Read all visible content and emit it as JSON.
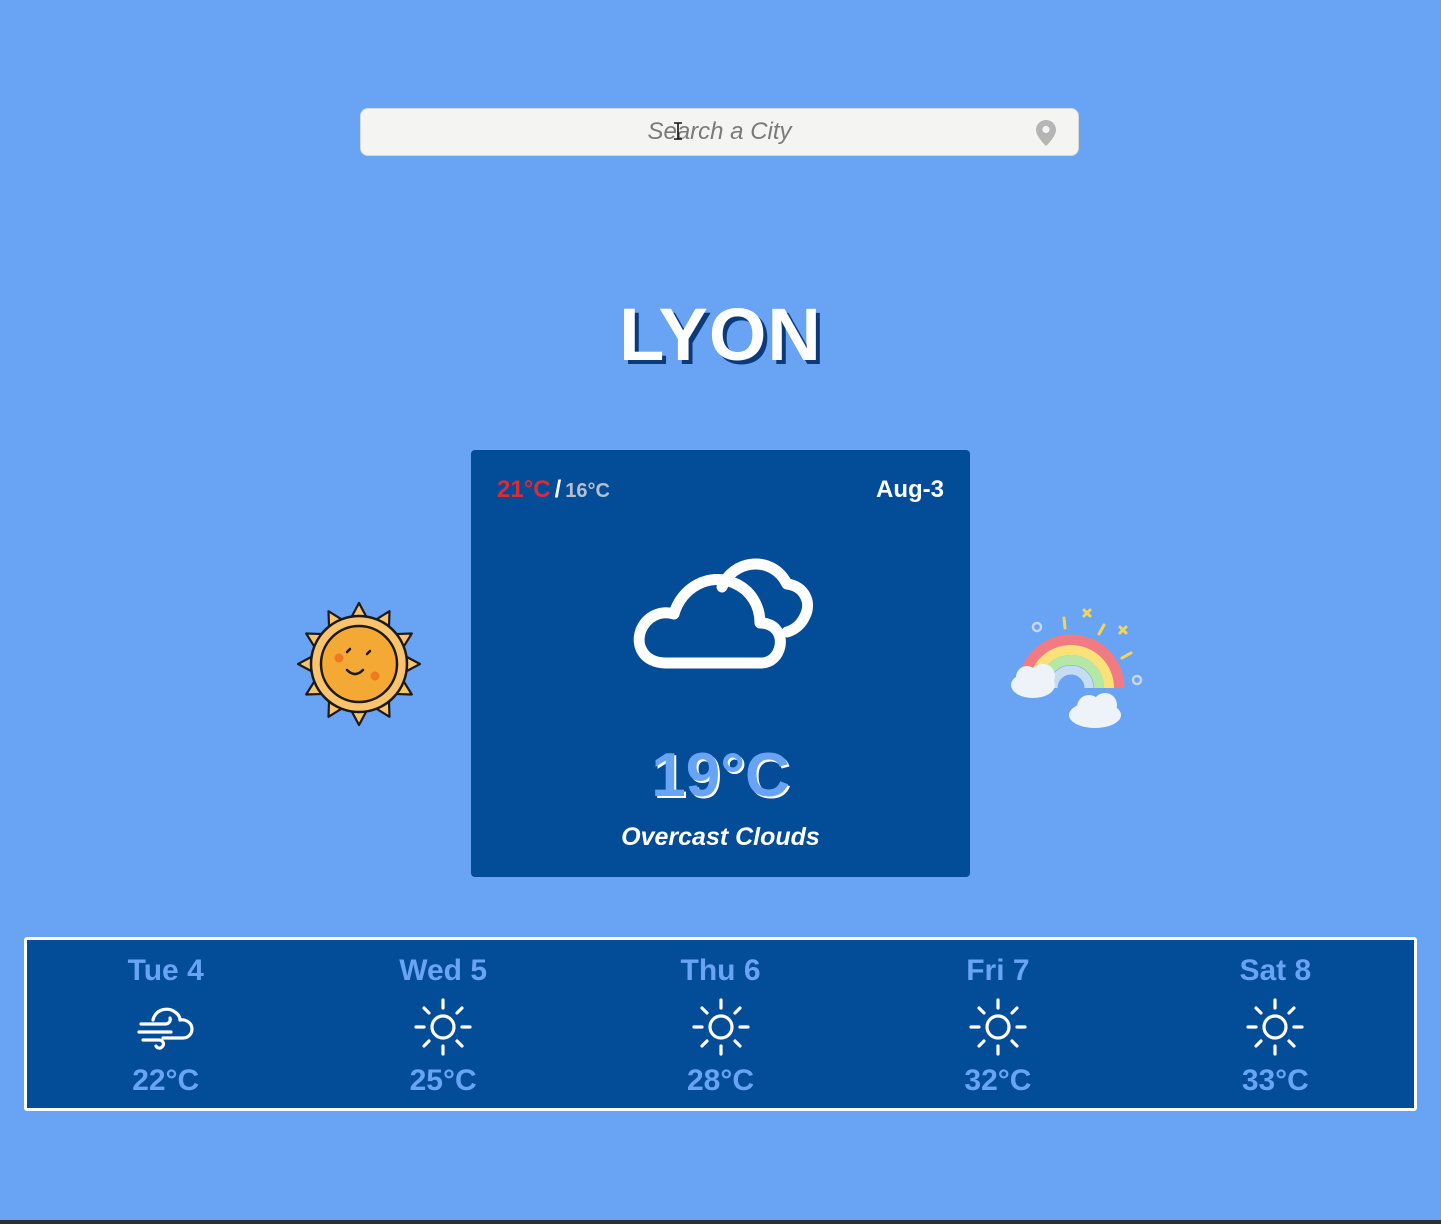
{
  "search": {
    "placeholder": "Search a City",
    "icon": "location-pin-icon"
  },
  "city": {
    "name": "LYON"
  },
  "current": {
    "temp_max": "21°C",
    "separator": "/",
    "temp_min": "16°C",
    "date": "Aug-3",
    "icon": "overcast-clouds-icon",
    "temp": "19°C",
    "condition": "Overcast Clouds"
  },
  "decorations": {
    "left": "smiling-sun-icon",
    "right": "rainbow-clouds-icon"
  },
  "forecast": [
    {
      "day": "Tue 4",
      "icon": "wind-cloud-icon",
      "temp": "22°C"
    },
    {
      "day": "Wed 5",
      "icon": "sun-icon",
      "temp": "25°C"
    },
    {
      "day": "Thu 6",
      "icon": "sun-icon",
      "temp": "28°C"
    },
    {
      "day": "Fri 7",
      "icon": "sun-icon",
      "temp": "32°C"
    },
    {
      "day": "Sat 8",
      "icon": "sun-icon",
      "temp": "33°C"
    }
  ],
  "colors": {
    "background": "#69a4f4",
    "card": "#034c97",
    "temp_max": "#d42e36",
    "temp_min": "#b6bfcc",
    "accent": "#69a4f4"
  }
}
